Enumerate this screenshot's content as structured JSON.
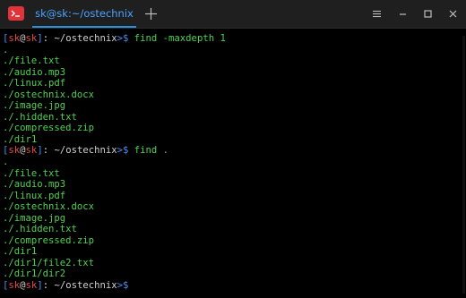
{
  "window": {
    "tab_title": "sk@sk:~/ostechnix"
  },
  "icons": {
    "app": "terminal-icon",
    "new_tab": "plus-icon",
    "menu": "hamburger-menu-icon",
    "minimize": "minimize-icon",
    "maximize": "maximize-icon",
    "close": "close-icon"
  },
  "colors": {
    "prompt_user_host": "#e24c4c",
    "prompt_brackets": "#4b8ef0",
    "command_and_output": "#4fd14f",
    "tab_accent": "#2f8fd8",
    "background": "#000000"
  },
  "prompt": {
    "open": "[",
    "user": "sk",
    "at": "@",
    "host": "sk",
    "close": "]",
    "sep": ": ",
    "path": "~/ostechnix",
    "symbol": ">$ "
  },
  "session": [
    {
      "command": "find -maxdepth 1",
      "output": [
        ".",
        "./file.txt",
        "./audio.mp3",
        "./linux.pdf",
        "./ostechnix.docx",
        "./image.jpg",
        "./.hidden.txt",
        "./compressed.zip",
        "./dir1"
      ]
    },
    {
      "command": "find .",
      "output": [
        ".",
        "./file.txt",
        "./audio.mp3",
        "./linux.pdf",
        "./ostechnix.docx",
        "./image.jpg",
        "./.hidden.txt",
        "./compressed.zip",
        "./dir1",
        "./dir1/file2.txt",
        "./dir1/dir2"
      ]
    },
    {
      "command": "",
      "output": []
    }
  ]
}
